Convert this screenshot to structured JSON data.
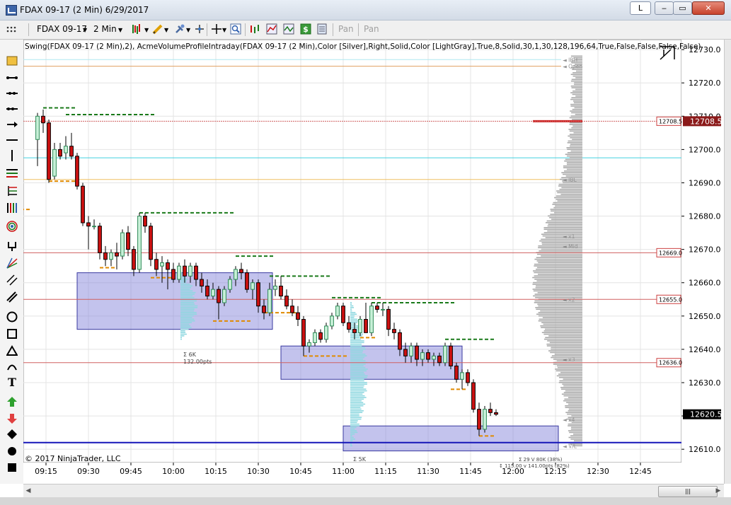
{
  "window": {
    "title": "FDAX 09-17 (2 Min)  6/29/2017",
    "link_button": "L",
    "minimize": "‒",
    "maximize": "▭",
    "close": "✕"
  },
  "toolbar": {
    "instrument": "FDAX 09-17",
    "interval": "2 Min",
    "pan1": "Pan",
    "pan2": "Pan"
  },
  "indicator_label": "Swing(FDAX 09-17 (2 Min),2), AcmeVolumeProfileIntraday(FDAX 09-17 (2 Min),Color [Silver],Right,Solid,Color [LightGray],True,8,Solid,30,1,30,128,196,64,True,False,False,False,False)",
  "watermark": "© 2017 NinjaTrader, LLC",
  "colors": {
    "up_candle": "#2e8b57",
    "down_candle": "#cc1111",
    "up_fill": "#c8f0d8",
    "value_box": "#7b7bd6",
    "profile": "#a9a9a9",
    "session_profile": "#8fd8e0",
    "swing_high": "#1a7a1a",
    "swing_low": "#e08a00",
    "last_price_bg": "#000000",
    "red_label_bg": "#8b1a1a"
  },
  "chart_data": {
    "type": "candlestick",
    "instrument": "FDAX 09-17",
    "interval": "2 Min",
    "date": "6/29/2017",
    "y_ticks": [
      "12730.0",
      "12720.0",
      "12710.0",
      "12700.0",
      "12690.0",
      "12680.0",
      "12670.0",
      "12660.0",
      "12650.0",
      "12640.0",
      "12630.0",
      "12620.0",
      "12610.0"
    ],
    "ylim": [
      12606,
      12733
    ],
    "x_ticks": [
      "09:15",
      "09:30",
      "09:45",
      "10:00",
      "10:15",
      "10:30",
      "10:45",
      "11:00",
      "11:15",
      "11:30",
      "11:45",
      "12:00",
      "12:15",
      "12:30",
      "12:45"
    ],
    "last_price": "12620.5",
    "red_price_label": "12708.5",
    "price_levels": [
      {
        "label": "12708.5",
        "value": 12708.5
      },
      {
        "label": "12669.0",
        "value": 12669.0
      },
      {
        "label": "12655.0",
        "value": 12655.0
      },
      {
        "label": "12636.0",
        "value": 12636.0
      }
    ],
    "level_tags": [
      {
        "label": "IBH",
        "value": 12727
      },
      {
        "label": "IBL",
        "value": 12691
      },
      {
        "label": "Open",
        "value": 12725
      },
      {
        "label": "x1",
        "value": 12674
      },
      {
        "label": "Mid",
        "value": 12671
      },
      {
        "label": "x2",
        "value": 12655
      },
      {
        "label": "x3",
        "value": 12637
      },
      {
        "label": "x4",
        "value": 12619
      },
      {
        "label": "V/L",
        "value": 12611
      }
    ],
    "profile_annotations": [
      {
        "text": "Σ 6K"
      },
      {
        "text": "132.00pts"
      },
      {
        "text": "Σ 5K"
      },
      {
        "text": "Σ 29 V 80K (38%)"
      },
      {
        "text": "↕ 115.00 v 141.00pts (82%)"
      }
    ],
    "candles": [
      {
        "t": "09:12",
        "o": 12703,
        "h": 12711,
        "l": 12695,
        "c": 12710
      },
      {
        "t": "09:14",
        "o": 12710,
        "h": 12712,
        "l": 12705,
        "c": 12708
      },
      {
        "t": "09:16",
        "o": 12708,
        "h": 12709,
        "l": 12690,
        "c": 12691
      },
      {
        "t": "09:18",
        "o": 12692,
        "h": 12702,
        "l": 12691,
        "c": 12700
      },
      {
        "t": "09:20",
        "o": 12700,
        "h": 12702,
        "l": 12697,
        "c": 12698
      },
      {
        "t": "09:22",
        "o": 12699,
        "h": 12704,
        "l": 12697,
        "c": 12701
      },
      {
        "t": "09:24",
        "o": 12701,
        "h": 12705,
        "l": 12697,
        "c": 12698
      },
      {
        "t": "09:26",
        "o": 12698,
        "h": 12699,
        "l": 12688,
        "c": 12689
      },
      {
        "t": "09:28",
        "o": 12689,
        "h": 12690,
        "l": 12677,
        "c": 12678
      },
      {
        "t": "09:30",
        "o": 12678,
        "h": 12680,
        "l": 12670,
        "c": 12677
      },
      {
        "t": "09:32",
        "o": 12677,
        "h": 12679,
        "l": 12676,
        "c": 12677
      },
      {
        "t": "09:34",
        "o": 12677,
        "h": 12678,
        "l": 12667,
        "c": 12669
      },
      {
        "t": "09:36",
        "o": 12669,
        "h": 12671,
        "l": 12665,
        "c": 12667
      },
      {
        "t": "09:38",
        "o": 12667,
        "h": 12670,
        "l": 12665,
        "c": 12669
      },
      {
        "t": "09:40",
        "o": 12669,
        "h": 12672,
        "l": 12664,
        "c": 12668
      },
      {
        "t": "09:42",
        "o": 12668,
        "h": 12676,
        "l": 12667,
        "c": 12675
      },
      {
        "t": "09:44",
        "o": 12675,
        "h": 12677,
        "l": 12668,
        "c": 12670
      },
      {
        "t": "09:46",
        "o": 12670,
        "h": 12671,
        "l": 12662,
        "c": 12664
      },
      {
        "t": "09:48",
        "o": 12664,
        "h": 12681,
        "l": 12663,
        "c": 12680
      },
      {
        "t": "09:50",
        "o": 12680,
        "h": 12681,
        "l": 12675,
        "c": 12677
      },
      {
        "t": "09:52",
        "o": 12677,
        "h": 12678,
        "l": 12665,
        "c": 12667
      },
      {
        "t": "09:54",
        "o": 12667,
        "h": 12669,
        "l": 12662,
        "c": 12664
      },
      {
        "t": "09:56",
        "o": 12665,
        "h": 12668,
        "l": 12660,
        "c": 12666
      },
      {
        "t": "09:58",
        "o": 12666,
        "h": 12667,
        "l": 12658,
        "c": 12664
      },
      {
        "t": "10:00",
        "o": 12664,
        "h": 12666,
        "l": 12660,
        "c": 12661
      },
      {
        "t": "10:02",
        "o": 12661,
        "h": 12666,
        "l": 12660,
        "c": 12665
      },
      {
        "t": "10:04",
        "o": 12665,
        "h": 12667,
        "l": 12660,
        "c": 12662
      },
      {
        "t": "10:06",
        "o": 12662,
        "h": 12666,
        "l": 12660,
        "c": 12665
      },
      {
        "t": "10:08",
        "o": 12665,
        "h": 12666,
        "l": 12659,
        "c": 12661
      },
      {
        "t": "10:10",
        "o": 12661,
        "h": 12663,
        "l": 12657,
        "c": 12659
      },
      {
        "t": "10:12",
        "o": 12659,
        "h": 12661,
        "l": 12655,
        "c": 12656
      },
      {
        "t": "10:14",
        "o": 12656,
        "h": 12660,
        "l": 12655,
        "c": 12658
      },
      {
        "t": "10:16",
        "o": 12658,
        "h": 12659,
        "l": 12649,
        "c": 12654
      },
      {
        "t": "10:18",
        "o": 12654,
        "h": 12659,
        "l": 12653,
        "c": 12658
      },
      {
        "t": "10:20",
        "o": 12658,
        "h": 12662,
        "l": 12657,
        "c": 12661
      },
      {
        "t": "10:22",
        "o": 12661,
        "h": 12665,
        "l": 12659,
        "c": 12664
      },
      {
        "t": "10:24",
        "o": 12664,
        "h": 12666,
        "l": 12661,
        "c": 12663
      },
      {
        "t": "10:26",
        "o": 12663,
        "h": 12664,
        "l": 12657,
        "c": 12658
      },
      {
        "t": "10:28",
        "o": 12658,
        "h": 12661,
        "l": 12655,
        "c": 12660
      },
      {
        "t": "10:30",
        "o": 12660,
        "h": 12661,
        "l": 12651,
        "c": 12653
      },
      {
        "t": "10:32",
        "o": 12653,
        "h": 12655,
        "l": 12649,
        "c": 12651
      },
      {
        "t": "10:34",
        "o": 12651,
        "h": 12660,
        "l": 12650,
        "c": 12658
      },
      {
        "t": "10:36",
        "o": 12658,
        "h": 12661,
        "l": 12656,
        "c": 12659
      },
      {
        "t": "10:38",
        "o": 12659,
        "h": 12662,
        "l": 12655,
        "c": 12656
      },
      {
        "t": "10:40",
        "o": 12656,
        "h": 12658,
        "l": 12652,
        "c": 12653
      },
      {
        "t": "10:42",
        "o": 12653,
        "h": 12655,
        "l": 12650,
        "c": 12651
      },
      {
        "t": "10:44",
        "o": 12651,
        "h": 12653,
        "l": 12647,
        "c": 12649
      },
      {
        "t": "10:46",
        "o": 12649,
        "h": 12650,
        "l": 12638,
        "c": 12641
      },
      {
        "t": "10:48",
        "o": 12641,
        "h": 12643,
        "l": 12639,
        "c": 12642
      },
      {
        "t": "10:50",
        "o": 12642,
        "h": 12646,
        "l": 12641,
        "c": 12645
      },
      {
        "t": "10:52",
        "o": 12645,
        "h": 12646,
        "l": 12642,
        "c": 12643
      },
      {
        "t": "10:54",
        "o": 12643,
        "h": 12648,
        "l": 12642,
        "c": 12647
      },
      {
        "t": "10:56",
        "o": 12647,
        "h": 12651,
        "l": 12646,
        "c": 12650
      },
      {
        "t": "10:58",
        "o": 12650,
        "h": 12654,
        "l": 12649,
        "c": 12653
      },
      {
        "t": "11:00",
        "o": 12653,
        "h": 12654,
        "l": 12647,
        "c": 12648
      },
      {
        "t": "11:02",
        "o": 12648,
        "h": 12650,
        "l": 12645,
        "c": 12646
      },
      {
        "t": "11:04",
        "o": 12646,
        "h": 12648,
        "l": 12643,
        "c": 12645
      },
      {
        "t": "11:06",
        "o": 12645,
        "h": 12650,
        "l": 12644,
        "c": 12649
      },
      {
        "t": "11:08",
        "o": 12649,
        "h": 12654,
        "l": 12645,
        "c": 12645
      },
      {
        "t": "11:10",
        "o": 12645,
        "h": 12654,
        "l": 12644,
        "c": 12653
      },
      {
        "t": "11:12",
        "o": 12653,
        "h": 12654,
        "l": 12651,
        "c": 12652
      },
      {
        "t": "11:14",
        "o": 12652,
        "h": 12654,
        "l": 12650,
        "c": 12652
      },
      {
        "t": "11:16",
        "o": 12652,
        "h": 12653,
        "l": 12644,
        "c": 12646
      },
      {
        "t": "11:18",
        "o": 12646,
        "h": 12648,
        "l": 12643,
        "c": 12645
      },
      {
        "t": "11:20",
        "o": 12645,
        "h": 12646,
        "l": 12638,
        "c": 12640
      },
      {
        "t": "11:22",
        "o": 12640,
        "h": 12642,
        "l": 12636,
        "c": 12638
      },
      {
        "t": "11:24",
        "o": 12638,
        "h": 12642,
        "l": 12636,
        "c": 12641
      },
      {
        "t": "11:26",
        "o": 12641,
        "h": 12642,
        "l": 12635,
        "c": 12637
      },
      {
        "t": "11:28",
        "o": 12637,
        "h": 12640,
        "l": 12635,
        "c": 12639
      },
      {
        "t": "11:30",
        "o": 12639,
        "h": 12640,
        "l": 12636,
        "c": 12637
      },
      {
        "t": "11:32",
        "o": 12637,
        "h": 12639,
        "l": 12635,
        "c": 12638
      },
      {
        "t": "11:34",
        "o": 12638,
        "h": 12639,
        "l": 12635,
        "c": 12636
      },
      {
        "t": "11:36",
        "o": 12636,
        "h": 12642,
        "l": 12635,
        "c": 12641
      },
      {
        "t": "11:38",
        "o": 12641,
        "h": 12642,
        "l": 12634,
        "c": 12635
      },
      {
        "t": "11:40",
        "o": 12635,
        "h": 12636,
        "l": 12630,
        "c": 12631
      },
      {
        "t": "11:42",
        "o": 12631,
        "h": 12634,
        "l": 12628,
        "c": 12633
      },
      {
        "t": "11:44",
        "o": 12633,
        "h": 12634,
        "l": 12629,
        "c": 12630
      },
      {
        "t": "11:46",
        "o": 12630,
        "h": 12631,
        "l": 12621,
        "c": 12622
      },
      {
        "t": "11:48",
        "o": 12622,
        "h": 12624,
        "l": 12614,
        "c": 12616
      },
      {
        "t": "11:50",
        "o": 12616,
        "h": 12623,
        "l": 12615,
        "c": 12622
      },
      {
        "t": "11:52",
        "o": 12622,
        "h": 12624,
        "l": 12620,
        "c": 12621
      },
      {
        "t": "11:54",
        "o": 12621,
        "h": 12622,
        "l": 12620,
        "c": 12620.5
      }
    ]
  }
}
